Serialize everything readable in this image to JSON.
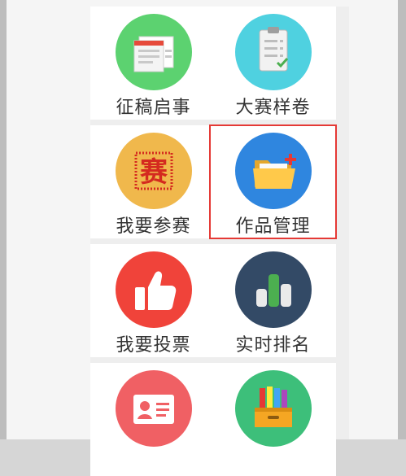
{
  "menu": {
    "items": [
      {
        "label": "征稿启事",
        "icon": "document-notice-icon",
        "color": "#5cd270"
      },
      {
        "label": "大赛样卷",
        "icon": "clipboard-checklist-icon",
        "color": "#4fd1e0"
      },
      {
        "label": "我要参赛",
        "icon": "seal-stamp-icon",
        "color": "#f0b84c"
      },
      {
        "label": "作品管理",
        "icon": "folder-add-icon",
        "color": "#2f86df",
        "selected": true
      },
      {
        "label": "我要投票",
        "icon": "thumbs-up-icon",
        "color": "#f0433a"
      },
      {
        "label": "实时排名",
        "icon": "bar-chart-icon",
        "color": "#334a66"
      },
      {
        "label": "",
        "icon": "id-card-icon",
        "color": "#f06064"
      },
      {
        "label": "",
        "icon": "file-drawer-icon",
        "color": "#3dbf7a"
      }
    ],
    "seal_text": "赛"
  }
}
